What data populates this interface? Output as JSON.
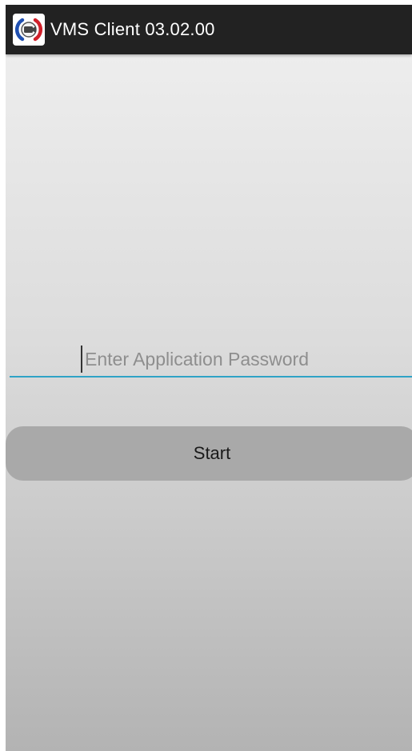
{
  "app": {
    "title": "VMS Client 03.02.00",
    "icon": "vms-camera-logo-icon"
  },
  "login": {
    "password_placeholder": "Enter Application Password",
    "password_value": "",
    "start_label": "Start"
  },
  "colors": {
    "action_bar": "#222222",
    "input_underline": "#2fa3c6",
    "button_bg": "#a9a9a9",
    "logo_blue": "#1f4fb0",
    "logo_red": "#d0202a"
  }
}
